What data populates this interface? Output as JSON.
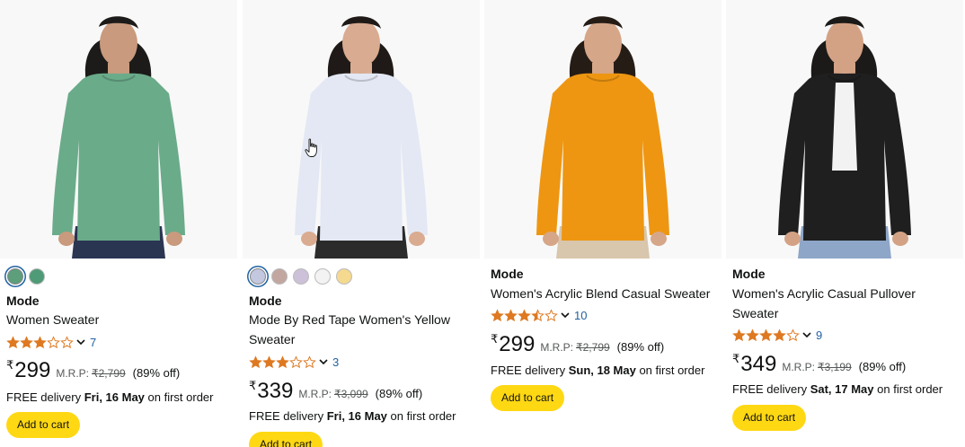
{
  "products": [
    {
      "brand": "Mode",
      "title": "Women Sweater",
      "rating": 3,
      "rating_count": "7",
      "currency": "₹",
      "price": "299",
      "mrp_label": "M.R.P:",
      "mrp": "₹2,799",
      "discount": "(89% off)",
      "delivery_prefix": "FREE delivery ",
      "delivery_date": "Fri, 16 May",
      "delivery_suffix": " on first order",
      "cart_label": "Add to cart",
      "swatches": [
        "#5d9e7b",
        "#4f9a77"
      ],
      "image": {
        "garment": "#6aab8a",
        "skin": "#c99a7d",
        "hair": "#1c1b19",
        "pants": "#2a3552"
      }
    },
    {
      "brand": "Mode",
      "title": "Mode By Red Tape Women's Yellow Sweater",
      "rating": 3,
      "rating_count": "3",
      "currency": "₹",
      "price": "339",
      "mrp_label": "M.R.P:",
      "mrp": "₹3,099",
      "discount": "(89% off)",
      "delivery_prefix": "FREE delivery ",
      "delivery_date": "Fri, 16 May",
      "delivery_suffix": " on first order",
      "cart_label": "Add to cart",
      "swatches": [
        "#c3c8e0",
        "#c2a7a1",
        "#cdc1d9",
        "#f3f3f3",
        "#f4d98f"
      ],
      "image": {
        "garment": "#e3e8f4",
        "skin": "#d9ab90",
        "hair": "#1f1a17",
        "pants": "#2b2b2b"
      }
    },
    {
      "brand": "Mode",
      "title": "Women's Acrylic Blend Casual Sweater",
      "rating": 3.5,
      "rating_count": "10",
      "currency": "₹",
      "price": "299",
      "mrp_label": "M.R.P:",
      "mrp": "₹2,799",
      "discount": "(89% off)",
      "delivery_prefix": "FREE delivery ",
      "delivery_date": "Sun, 18 May",
      "delivery_suffix": " on first order",
      "cart_label": "Add to cart",
      "swatches": [],
      "image": {
        "garment": "#ee9611",
        "skin": "#d6a689",
        "hair": "#261c16",
        "pants": "#d8c6ad"
      }
    },
    {
      "brand": "Mode",
      "title": "Women's Acrylic Casual Pullover Sweater",
      "rating": 4,
      "rating_count": "9",
      "currency": "₹",
      "price": "349",
      "mrp_label": "M.R.P:",
      "mrp": "₹3,199",
      "discount": "(89% off)",
      "delivery_prefix": "FREE delivery ",
      "delivery_date": "Sat, 17 May",
      "delivery_suffix": " on first order",
      "cart_label": "Add to cart",
      "swatches": [],
      "image": {
        "garment": "#1f1f1f",
        "skin": "#d3a285",
        "hair": "#1c1a18",
        "pants": "#8ea6c8"
      }
    }
  ],
  "colors": {
    "accent_link": "#2162a1",
    "star": "#de7921",
    "cart_button": "#ffd814"
  }
}
